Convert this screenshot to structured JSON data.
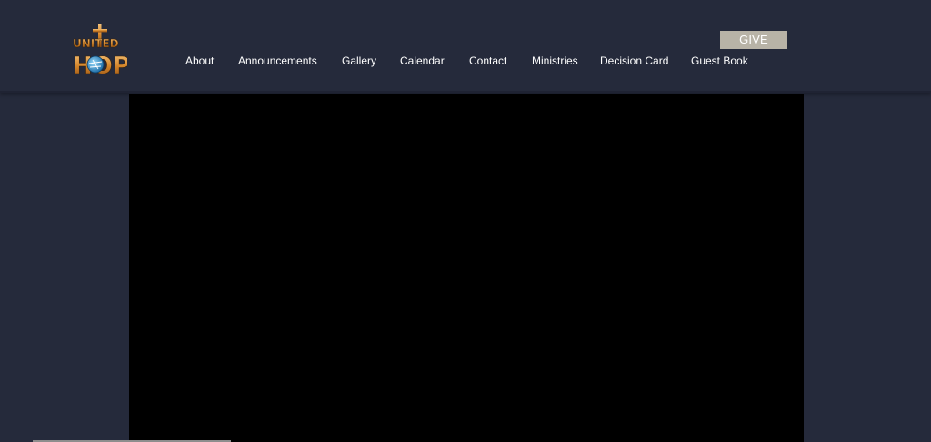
{
  "brand": {
    "logo_line1": "UNITED",
    "logo_line2": "HOPE"
  },
  "header": {
    "give_label": "GIVE"
  },
  "nav": {
    "items": [
      {
        "label": "About"
      },
      {
        "label": "Announcements"
      },
      {
        "label": "Gallery"
      },
      {
        "label": "Calendar"
      },
      {
        "label": "Contact"
      },
      {
        "label": "Ministries"
      },
      {
        "label": "Decision Card"
      },
      {
        "label": "Guest Book"
      }
    ]
  },
  "colors": {
    "background": "#252a3b",
    "give_button": "#b8b3a7",
    "video": "#000000",
    "logo_orange": "#d4852a",
    "logo_blue": "#3fa7d6"
  },
  "icons": {
    "logo": "united-hope-cross-globe-logo"
  }
}
